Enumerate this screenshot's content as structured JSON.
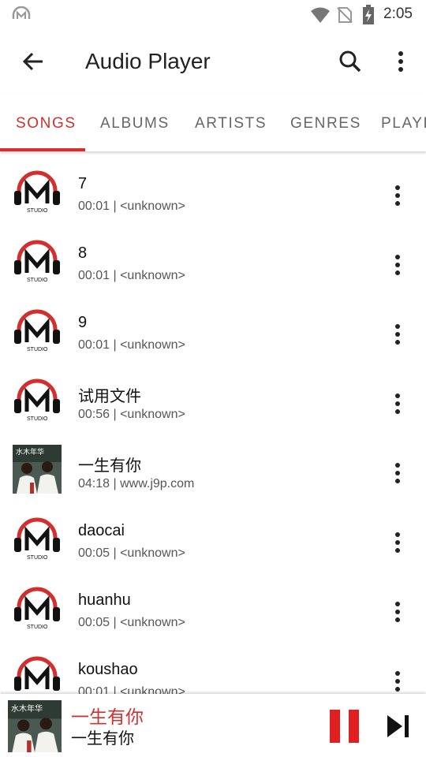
{
  "status": {
    "time": "2:05"
  },
  "toolbar": {
    "title": "Audio Player"
  },
  "tabs": [
    {
      "label": "SONGS"
    },
    {
      "label": "ALBUMS"
    },
    {
      "label": "ARTISTS"
    },
    {
      "label": "GENRES"
    },
    {
      "label": "PLAYL"
    }
  ],
  "songs": [
    {
      "title": "7",
      "subtitle": "00:01 | <unknown>",
      "art": "studio-logo-icon"
    },
    {
      "title": "8",
      "subtitle": "00:01 | <unknown>",
      "art": "studio-logo-icon"
    },
    {
      "title": "9",
      "subtitle": "00:01 | <unknown>",
      "art": "studio-logo-icon"
    },
    {
      "title": "试用文件",
      "subtitle": "00:56 | <unknown>",
      "art": "studio-logo-icon"
    },
    {
      "title": "一生有你",
      "subtitle": "04:18 | www.j9p.com",
      "art": "album-cover"
    },
    {
      "title": "daocai",
      "subtitle": "00:05 | <unknown>",
      "art": "studio-logo-icon"
    },
    {
      "title": "huanhu",
      "subtitle": "00:05 | <unknown>",
      "art": "studio-logo-icon"
    },
    {
      "title": "koushao",
      "subtitle": "00:01 | <unknown>",
      "art": "studio-logo-icon"
    }
  ],
  "logo_text": "STUDIO",
  "cover_text": "水木年华",
  "now_playing": {
    "title": "一生有你",
    "subtitle": "一生有你"
  },
  "colors": {
    "accent": "#d32f2f",
    "text": "#111111",
    "secondary": "#555555"
  }
}
